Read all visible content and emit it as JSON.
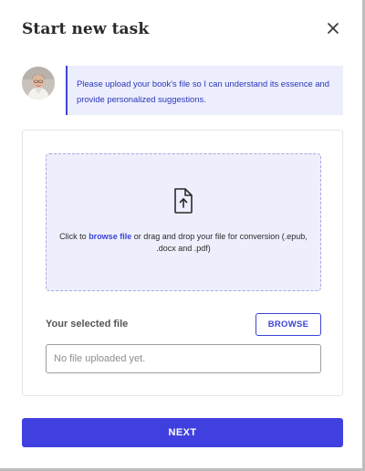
{
  "dialog": {
    "title": "Start new task"
  },
  "assistant": {
    "message": "Please upload your book's file so I can understand its essence and provide personalized suggestions.",
    "avatar_icon": "user-photo"
  },
  "upload": {
    "prompt_prefix": "Click to ",
    "browse_link": "browse file",
    "prompt_suffix": " or drag and drop your file for conversion (.epub, .docx and .pdf)",
    "selected_label": "Your selected file",
    "browse_button": "BROWSE",
    "file_placeholder": "No file uploaded yet.",
    "file_value": ""
  },
  "footer": {
    "next_button": "NEXT"
  },
  "colors": {
    "accent": "#4040e0",
    "bubble_bg": "#eceefe",
    "dropzone_bg": "#eeeffc"
  }
}
